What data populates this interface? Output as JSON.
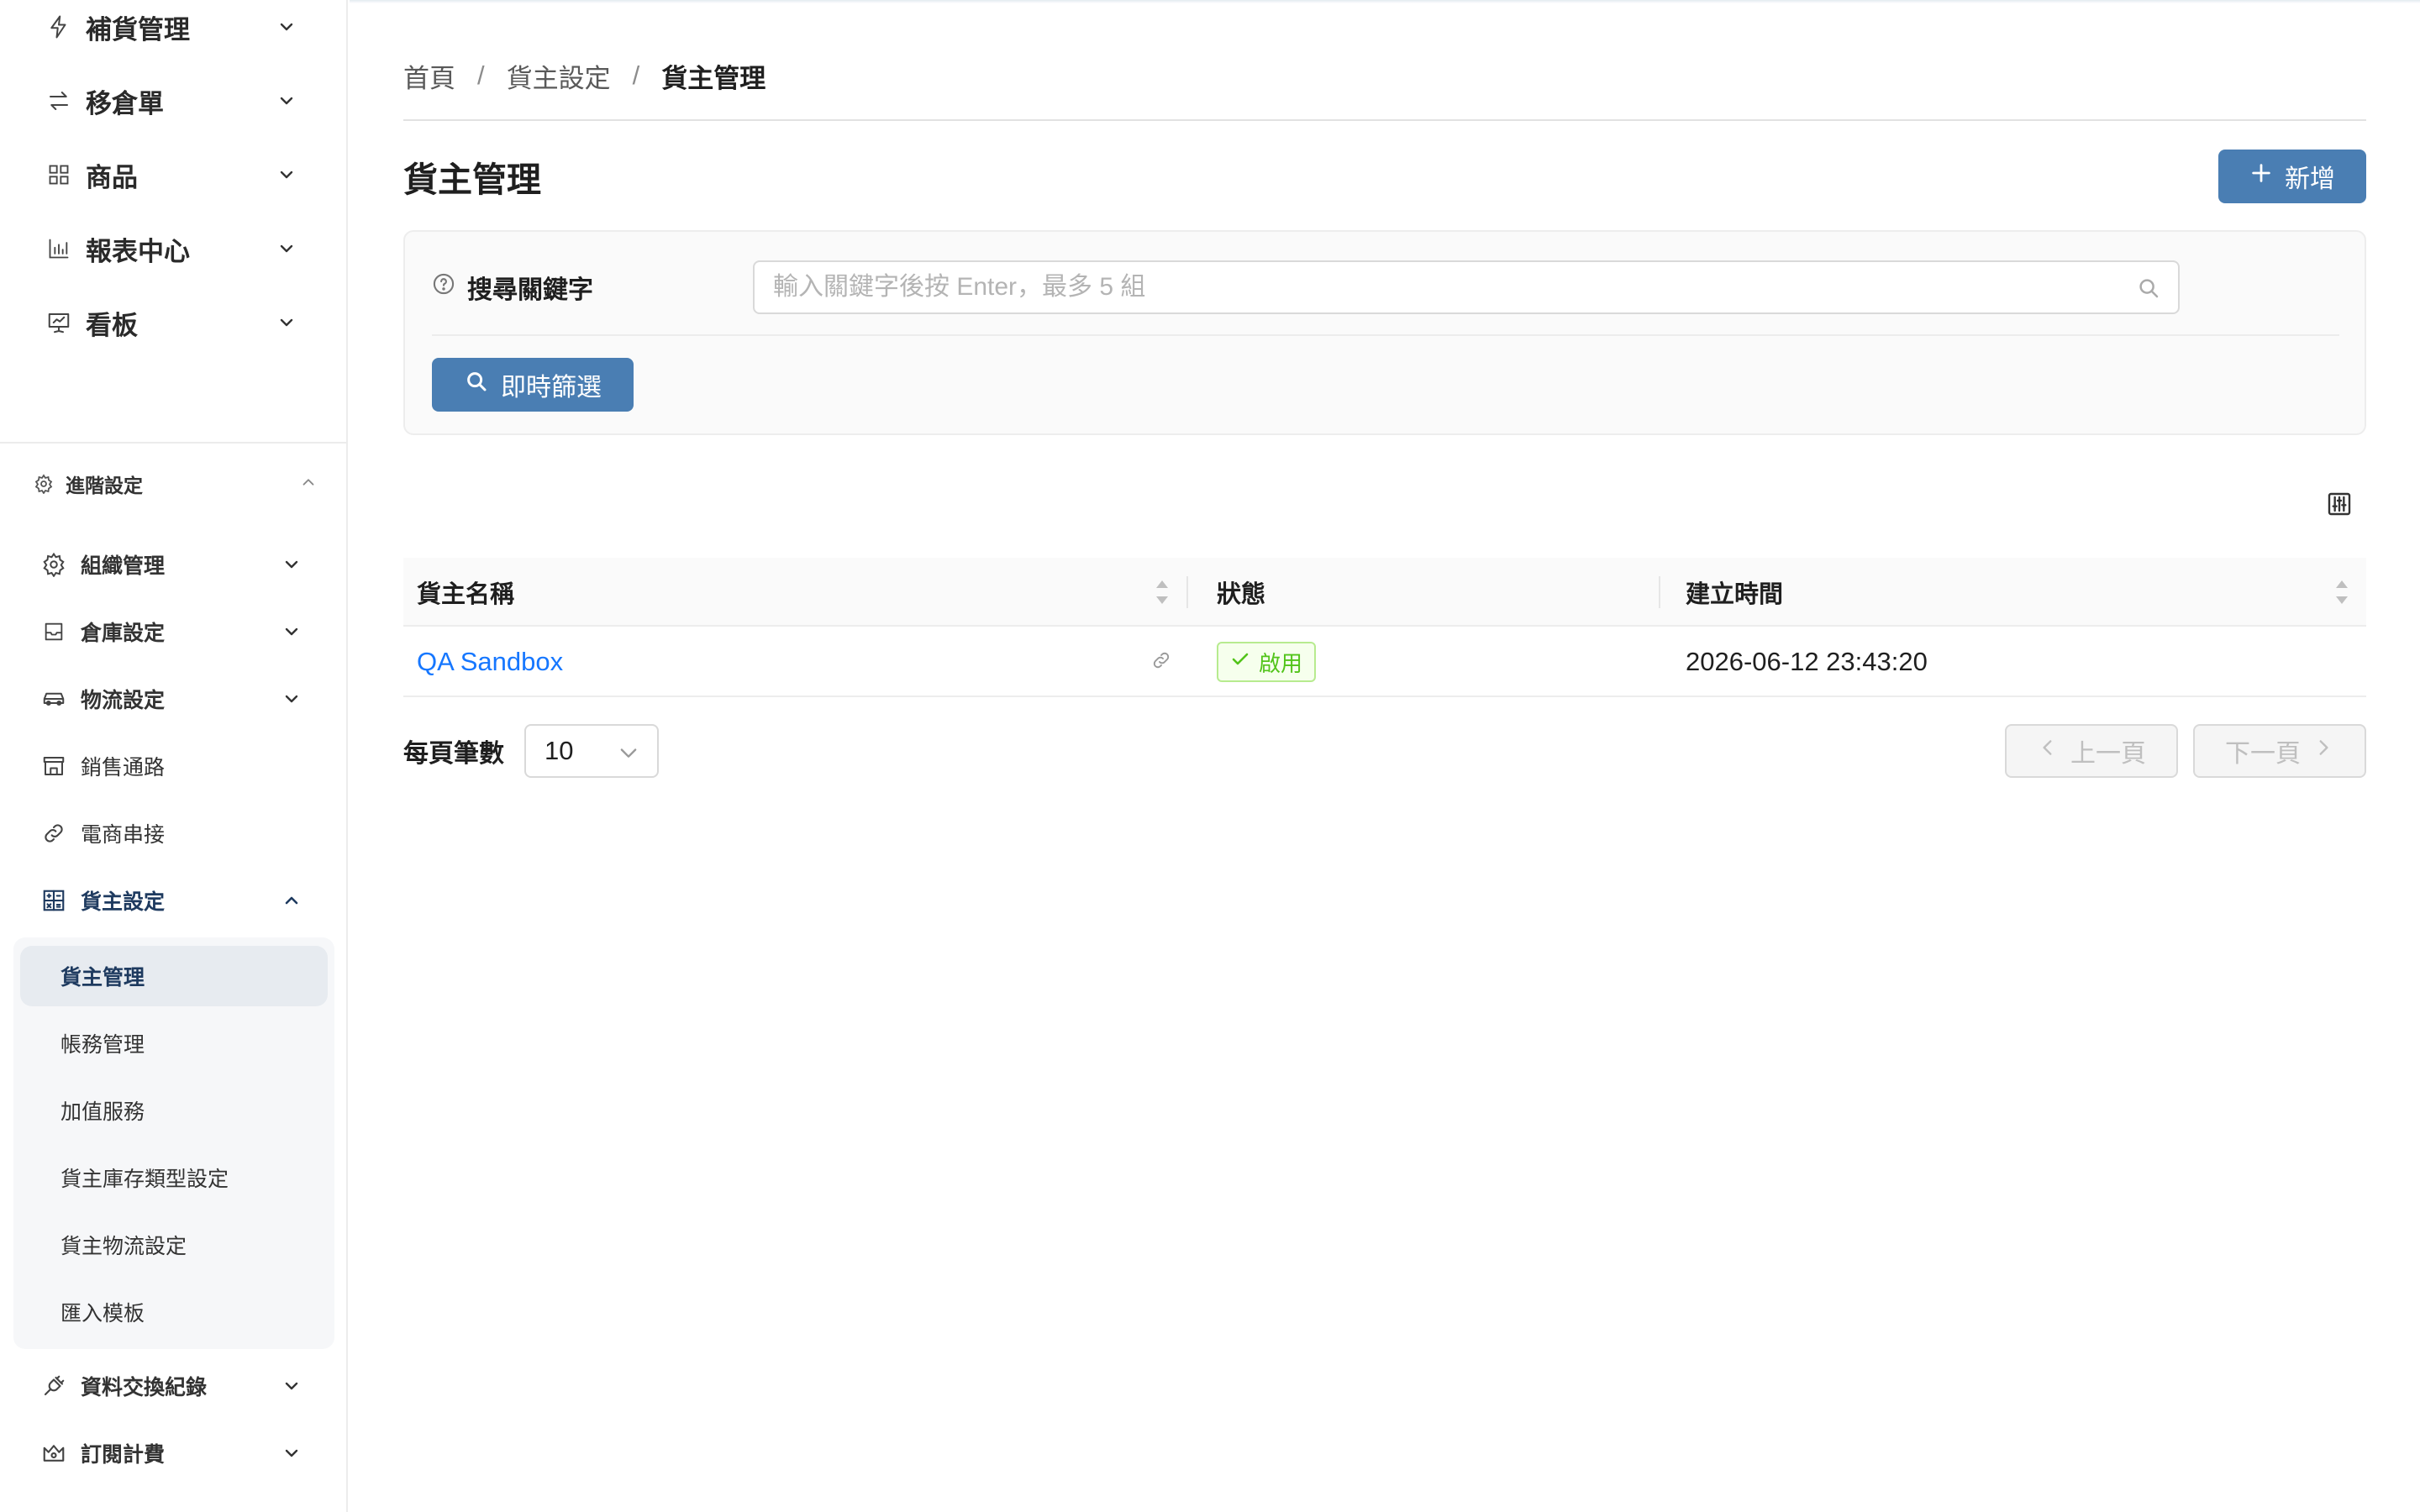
{
  "sidebar": {
    "top_items": [
      {
        "label": "補貨管理",
        "icon": "lightning-icon"
      },
      {
        "label": "移倉單",
        "icon": "transfer-arrows-icon"
      },
      {
        "label": "商品",
        "icon": "grid-icon"
      },
      {
        "label": "報表中心",
        "icon": "bar-chart-icon"
      },
      {
        "label": "看板",
        "icon": "presentation-icon"
      }
    ],
    "section": {
      "label": "進階設定",
      "icon": "gear-icon",
      "expanded": true
    },
    "section_items": [
      {
        "label": "組織管理",
        "icon": "gear-icon"
      },
      {
        "label": "倉庫設定",
        "icon": "inbox-icon"
      },
      {
        "label": "物流設定",
        "icon": "car-icon"
      },
      {
        "label": "銷售通路",
        "icon": "shop-icon"
      },
      {
        "label": "電商串接",
        "icon": "link-icon"
      },
      {
        "label": "貨主設定",
        "icon": "calculator-icon"
      }
    ],
    "owner_submenu": [
      {
        "label": "貨主管理",
        "active": true
      },
      {
        "label": "帳務管理"
      },
      {
        "label": "加值服務"
      },
      {
        "label": "貨主庫存類型設定"
      },
      {
        "label": "貨主物流設定"
      },
      {
        "label": "匯入模板"
      }
    ],
    "bottom_items": [
      {
        "label": "資料交換紀錄",
        "icon": "api-plug-icon"
      },
      {
        "label": "訂閱計費",
        "icon": "crown-icon"
      }
    ]
  },
  "breadcrumb": {
    "home": "首頁",
    "parent": "貨主設定",
    "current": "貨主管理",
    "separator": "/"
  },
  "page": {
    "title": "貨主管理",
    "add_button": "新增"
  },
  "filter": {
    "label": "搜尋關鍵字",
    "placeholder": "輸入關鍵字後按 Enter，最多 5 組",
    "value": "",
    "button": "即時篩選"
  },
  "table": {
    "columns": [
      "貨主名稱",
      "狀態",
      "建立時間"
    ],
    "rows": [
      {
        "name": "QA Sandbox",
        "status": "啟用",
        "created_at": "2026-06-12 23:43:20"
      }
    ]
  },
  "pagination": {
    "page_size_label": "每頁筆數",
    "page_size": "10",
    "prev": "上一頁",
    "next": "下一頁"
  },
  "colors": {
    "primary": "#4a7eb3",
    "link": "#1677ff",
    "success": "#52c41a",
    "active_nav": "#1e3a5f"
  }
}
